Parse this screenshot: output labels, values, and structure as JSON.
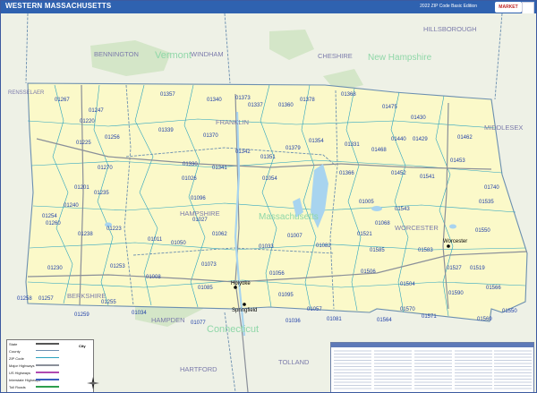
{
  "header": {
    "title": "WESTERN MASSACHUSETTS",
    "edition": "2022 ZIP Code Basic Edition",
    "brand": "MARKET MAPS"
  },
  "colors": {
    "title_bar": "#2f62b0",
    "main_area": "#fbf9c9",
    "surroundings": "#eef1e6",
    "forest": "#d4e6c8",
    "water": "#a8d4ef",
    "zip_lines": "#2aa3bf",
    "county_lines": "#6b8fb0",
    "highways": "#8a8f99",
    "state_label": "#8fd7a8",
    "county_label": "#7b7bab"
  },
  "state_labels": [
    {
      "text": "Vermont"
    },
    {
      "text": "New Hampshire"
    },
    {
      "text": "Massachusetts"
    },
    {
      "text": "Connecticut"
    }
  ],
  "county_labels": [
    {
      "text": "BENNINGTON"
    },
    {
      "text": "WINDHAM"
    },
    {
      "text": "CHESHIRE"
    },
    {
      "text": "HILLSBOROUGH"
    },
    {
      "text": "RENSSELAER"
    },
    {
      "text": "MIDDLESEX"
    },
    {
      "text": "FRANKLIN"
    },
    {
      "text": "HAMPSHIRE"
    },
    {
      "text": "WORCESTER"
    },
    {
      "text": "BERKSHIRE"
    },
    {
      "text": "HAMPDEN"
    },
    {
      "text": "HARTFORD"
    },
    {
      "text": "TOLLAND"
    }
  ],
  "cities": [
    {
      "name": "Worcester"
    },
    {
      "name": "Holyoke"
    },
    {
      "name": "Springfield"
    }
  ],
  "zip_codes": [
    {
      "code": "01267"
    },
    {
      "code": "01247"
    },
    {
      "code": "01220"
    },
    {
      "code": "01256"
    },
    {
      "code": "01225"
    },
    {
      "code": "01270"
    },
    {
      "code": "01235"
    },
    {
      "code": "01201"
    },
    {
      "code": "01254"
    },
    {
      "code": "01240"
    },
    {
      "code": "01260"
    },
    {
      "code": "01238"
    },
    {
      "code": "01223"
    },
    {
      "code": "01011"
    },
    {
      "code": "01230"
    },
    {
      "code": "01253"
    },
    {
      "code": "01258"
    },
    {
      "code": "01257"
    },
    {
      "code": "01259"
    },
    {
      "code": "01255"
    },
    {
      "code": "01034"
    },
    {
      "code": "01008"
    },
    {
      "code": "01085"
    },
    {
      "code": "01077"
    },
    {
      "code": "01357"
    },
    {
      "code": "01340"
    },
    {
      "code": "01339"
    },
    {
      "code": "01370"
    },
    {
      "code": "01330"
    },
    {
      "code": "01026"
    },
    {
      "code": "01096"
    },
    {
      "code": "01027"
    },
    {
      "code": "01341"
    },
    {
      "code": "01373"
    },
    {
      "code": "01337"
    },
    {
      "code": "01360"
    },
    {
      "code": "01378"
    },
    {
      "code": "01342"
    },
    {
      "code": "01351"
    },
    {
      "code": "01379"
    },
    {
      "code": "01354"
    },
    {
      "code": "01054"
    },
    {
      "code": "01062"
    },
    {
      "code": "01050"
    },
    {
      "code": "01073"
    },
    {
      "code": "01033"
    },
    {
      "code": "01007"
    },
    {
      "code": "01082"
    },
    {
      "code": "01056"
    },
    {
      "code": "01095"
    },
    {
      "code": "01036"
    },
    {
      "code": "01057"
    },
    {
      "code": "01081"
    },
    {
      "code": "01368"
    },
    {
      "code": "01475"
    },
    {
      "code": "01331"
    },
    {
      "code": "01468"
    },
    {
      "code": "01440"
    },
    {
      "code": "01429"
    },
    {
      "code": "01430"
    },
    {
      "code": "01462"
    },
    {
      "code": "01453"
    },
    {
      "code": "01452"
    },
    {
      "code": "01541"
    },
    {
      "code": "01366"
    },
    {
      "code": "01005"
    },
    {
      "code": "01543"
    },
    {
      "code": "01068"
    },
    {
      "code": "01521"
    },
    {
      "code": "01585"
    },
    {
      "code": "01535"
    },
    {
      "code": "01550"
    },
    {
      "code": "01527"
    },
    {
      "code": "01519"
    },
    {
      "code": "01566"
    },
    {
      "code": "01590"
    },
    {
      "code": "01550"
    },
    {
      "code": "01569"
    },
    {
      "code": "01571"
    },
    {
      "code": "01570"
    },
    {
      "code": "01506"
    },
    {
      "code": "01504"
    },
    {
      "code": "01564"
    },
    {
      "code": "01583"
    },
    {
      "code": "01740"
    }
  ],
  "legend": {
    "items": [
      {
        "label": "State"
      },
      {
        "label": "County"
      },
      {
        "label": "ZIP Code"
      },
      {
        "label": "Major Highways"
      },
      {
        "label": "US Highways"
      },
      {
        "label": "Interstate Highways"
      },
      {
        "label": "Toll Roads"
      }
    ],
    "city_key": "City"
  },
  "map_index": {
    "title": "ZIP Code Index"
  }
}
